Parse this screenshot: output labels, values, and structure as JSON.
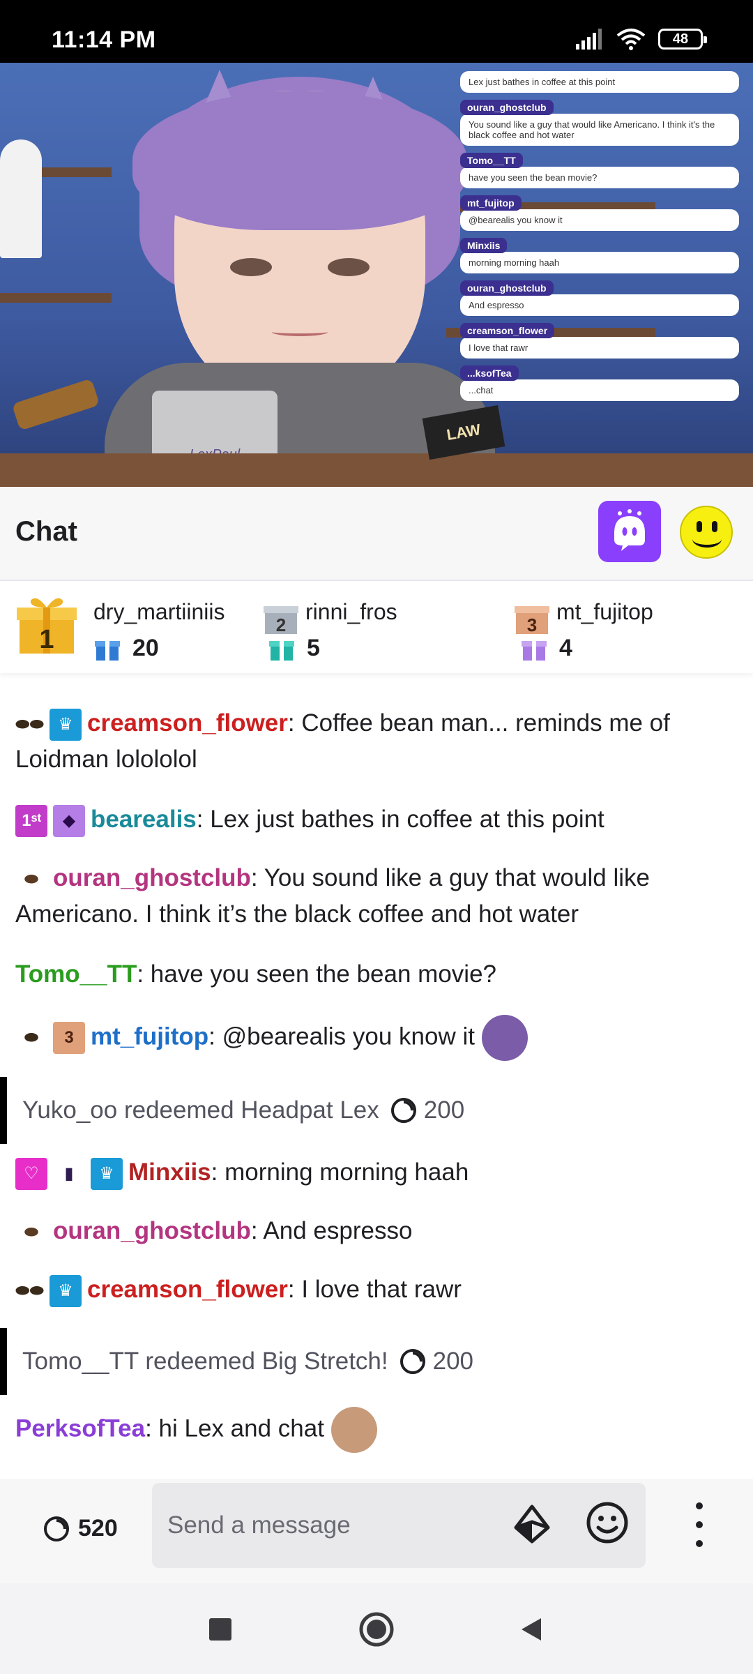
{
  "status_bar": {
    "time": "11:14 PM",
    "battery": "48"
  },
  "stream_overlay": {
    "top_line": "Lex just bathes in coffee at this point",
    "messages": [
      {
        "name": "ouran_ghostclub",
        "text": "You sound like a guy that would like Americano. I think it's the black coffee and hot water"
      },
      {
        "name": "Tomo__TT",
        "text": "have you seen the bean movie?"
      },
      {
        "name": "mt_fujitop",
        "text": "@bearealis you know it"
      },
      {
        "name": "Minxiis",
        "text": "morning morning haah"
      },
      {
        "name": "ouran_ghostclub",
        "text": "And espresso"
      },
      {
        "name": "creamson_flower",
        "text": "I love that rawr"
      },
      {
        "name": "...ksofTea",
        "text": "...chat"
      }
    ],
    "desk_sign": "LAW",
    "laptop_label": "LexPaul"
  },
  "chat_header": {
    "title": "Chat"
  },
  "leaderboard": [
    {
      "rank": "1",
      "name": "dry_martiiniis",
      "gifts": "20",
      "gift_color": "#2f7bd3"
    },
    {
      "rank": "2",
      "name": "rinni_fros",
      "gifts": "5",
      "gift_color": "#21b3a4"
    },
    {
      "rank": "3",
      "name": "mt_fujitop",
      "gifts": "4",
      "gift_color": "#a97ae6"
    }
  ],
  "messages": [
    {
      "user": "creamson_flower",
      "color": "#cc1f1f",
      "text": ": Coffee bean man... reminds me of Loidman lolololol"
    },
    {
      "user": "bearealis",
      "color": "#1a8a9a",
      "text": ": Lex just bathes in coffee at this point"
    },
    {
      "user": "ouran_ghostclub",
      "color": "#b4357f",
      "text": ": You sound like a guy that would like Americano. I think it’s the black coffee and hot water"
    },
    {
      "user": "Tomo__TT",
      "color": "#2a9c1f",
      "text": ": have you seen the bean movie?"
    },
    {
      "user": "mt_fujitop",
      "color": "#1e6fc8",
      "text": ": @bearealis you know it"
    },
    {
      "user": "Minxiis",
      "color": "#b22222",
      "text": ": morning morning haah"
    },
    {
      "user": "ouran_ghostclub",
      "color": "#b4357f",
      "text": ": And espresso"
    },
    {
      "user": "creamson_flower",
      "color": "#cc1f1f",
      "text": ": I love that rawr"
    },
    {
      "user": "PerksofTea",
      "color": "#8a3ed6",
      "text": ": hi Lex and chat"
    }
  ],
  "redeems": [
    {
      "text": "Yuko_oo redeemed Headpat Lex",
      "points": "200"
    },
    {
      "text": "Tomo__TT redeemed Big Stretch!",
      "points": "200"
    }
  ],
  "input": {
    "points": "520",
    "placeholder": "Send a message"
  }
}
